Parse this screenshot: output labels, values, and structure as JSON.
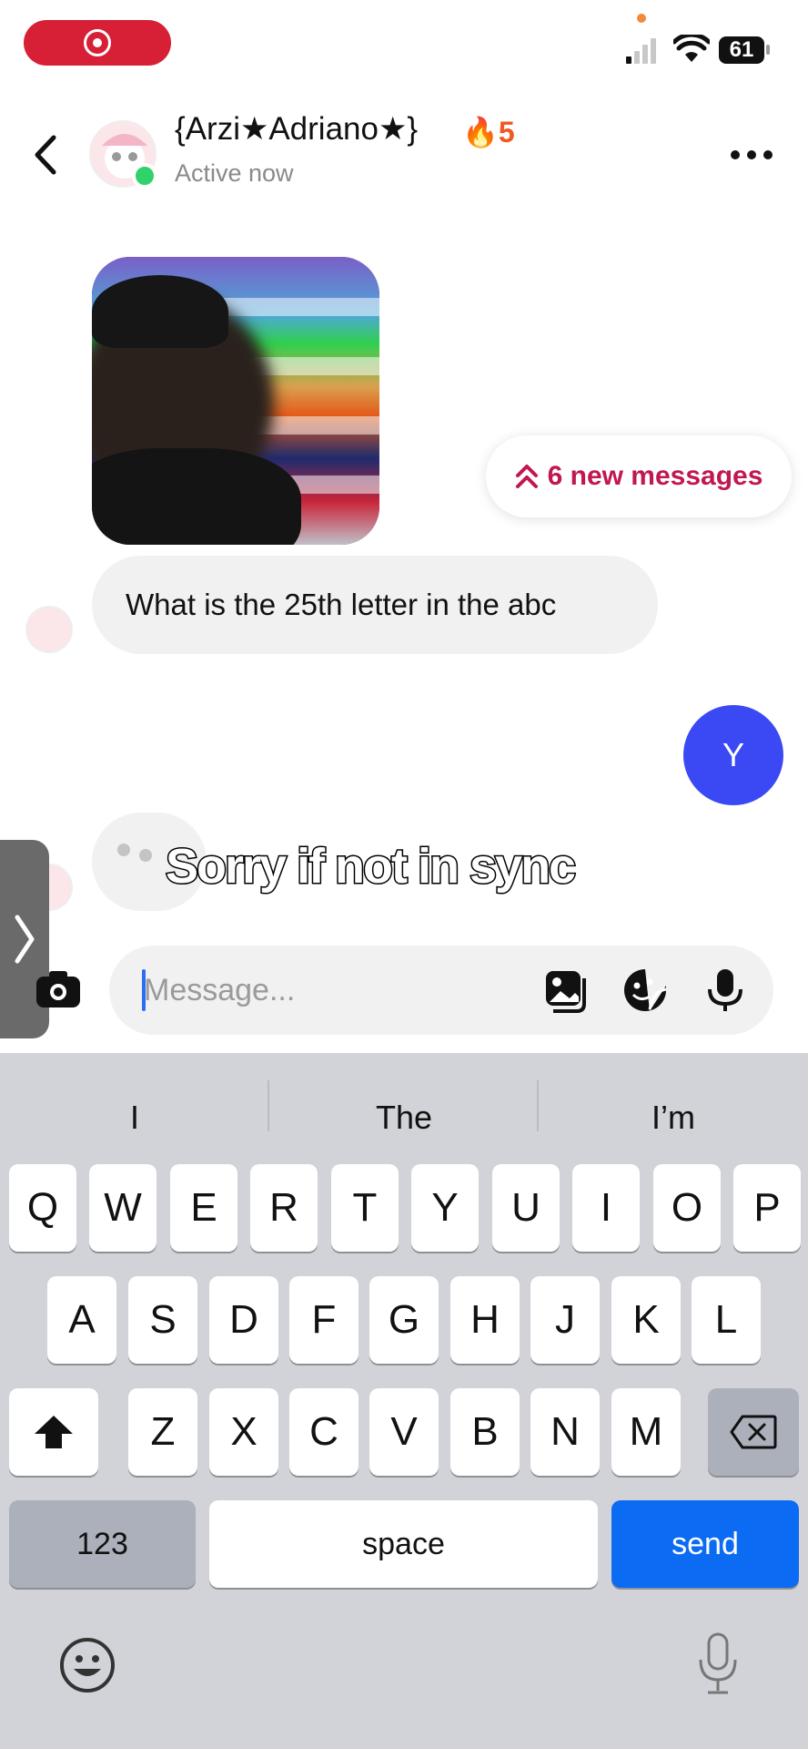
{
  "contact": {
    "name": "{Arzi★Adriano★}",
    "streak": "5",
    "status": "Active now"
  },
  "chat": {
    "new_messages_label": "6 new messages",
    "incoming_message": "What is the 25th letter in the abc",
    "outgoing_avatar_letter": "Y",
    "video_caption": "Sorry if not in sync"
  },
  "composer": {
    "placeholder": "Message..."
  },
  "keyboard": {
    "suggestions": [
      "I",
      "The",
      "I’m"
    ],
    "row1": [
      "Q",
      "W",
      "E",
      "R",
      "T",
      "Y",
      "U",
      "I",
      "O",
      "P"
    ],
    "row2": [
      "A",
      "S",
      "D",
      "F",
      "G",
      "H",
      "J",
      "K",
      "L"
    ],
    "row3": [
      "Z",
      "X",
      "C",
      "V",
      "B",
      "N",
      "M"
    ],
    "numbers_label": "123",
    "space_label": "space",
    "send_label": "send"
  },
  "status_bar": {
    "battery": "61"
  },
  "colors": {
    "accent_red": "#c0184f",
    "send_blue": "#0b6cf3",
    "avatar_blue": "#3b49f5",
    "online_green": "#2fd36a",
    "record_red": "#d71f36"
  }
}
